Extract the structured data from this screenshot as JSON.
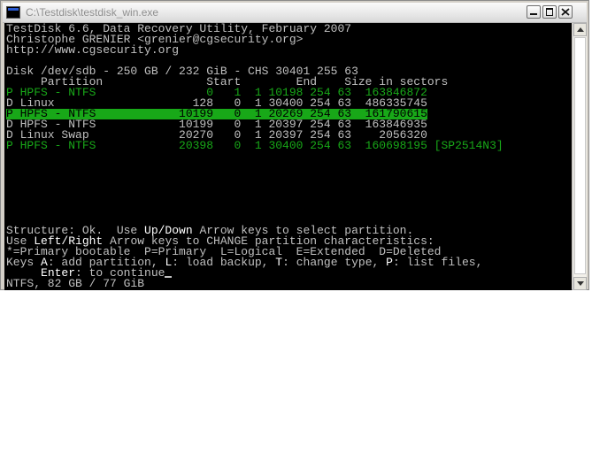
{
  "window": {
    "title": "C:\\Testdisk\\testdisk_win.exe"
  },
  "console": {
    "header": [
      "TestDisk 6.6, Data Recovery Utility, February 2007",
      "Christophe GRENIER <grenier@cgsecurity.org>",
      "http://www.cgsecurity.org"
    ],
    "disk_line": "Disk /dev/sdb - 250 GB / 232 GiB - CHS 30401 255 63",
    "column_headers": "     Partition               Start        End    Size in sectors",
    "partitions": [
      {
        "text": "P HPFS - NTFS                0   1  1 10198 254 63  163846872",
        "style": "green"
      },
      {
        "text": "D Linux                    128   0  1 30400 254 63  486335745",
        "style": "normal"
      },
      {
        "text": "P HPFS - NTFS            10199   0  1 20269 254 63  161790615",
        "style": "selected"
      },
      {
        "text": "D HPFS - NTFS            10199   0  1 20397 254 63  163846935",
        "style": "normal"
      },
      {
        "text": "D Linux Swap             20270   0  1 20397 254 63    2056320",
        "style": "normal"
      },
      {
        "text": "P HPFS - NTFS            20398   0  1 30400 254 63  160698195 [SP2514N3]",
        "style": "green"
      }
    ],
    "help": {
      "l1_a": "Structure: Ok.  Use ",
      "l1_b": "Up/Down",
      "l1_c": " Arrow keys to select partition.",
      "l2_a": "Use ",
      "l2_b": "Left/Right",
      "l2_c": " Arrow keys to CHANGE partition characteristics:",
      "l3": "*=Primary bootable  P=Primary  L=Logical  E=Extended  D=Deleted",
      "l4_a": "Keys ",
      "l4_b": "A",
      "l4_c": ": add partition, ",
      "l4_d": "L",
      "l4_e": ": load backup, ",
      "l4_f": "T",
      "l4_g": ": change type, ",
      "l4_h": "P",
      "l4_i": ": list files,",
      "l5_a": "     ",
      "l5_b": "Enter",
      "l5_c": ": to continue"
    },
    "status": "NTFS, 82 GB / 77 GiB"
  },
  "colors": {
    "highlight": "#18a818",
    "text": "#c0c0c0",
    "background": "#000000"
  },
  "icons": [
    "console-app-icon",
    "minimize-icon",
    "maximize-icon",
    "close-icon",
    "scroll-up-icon",
    "scroll-down-icon"
  ]
}
